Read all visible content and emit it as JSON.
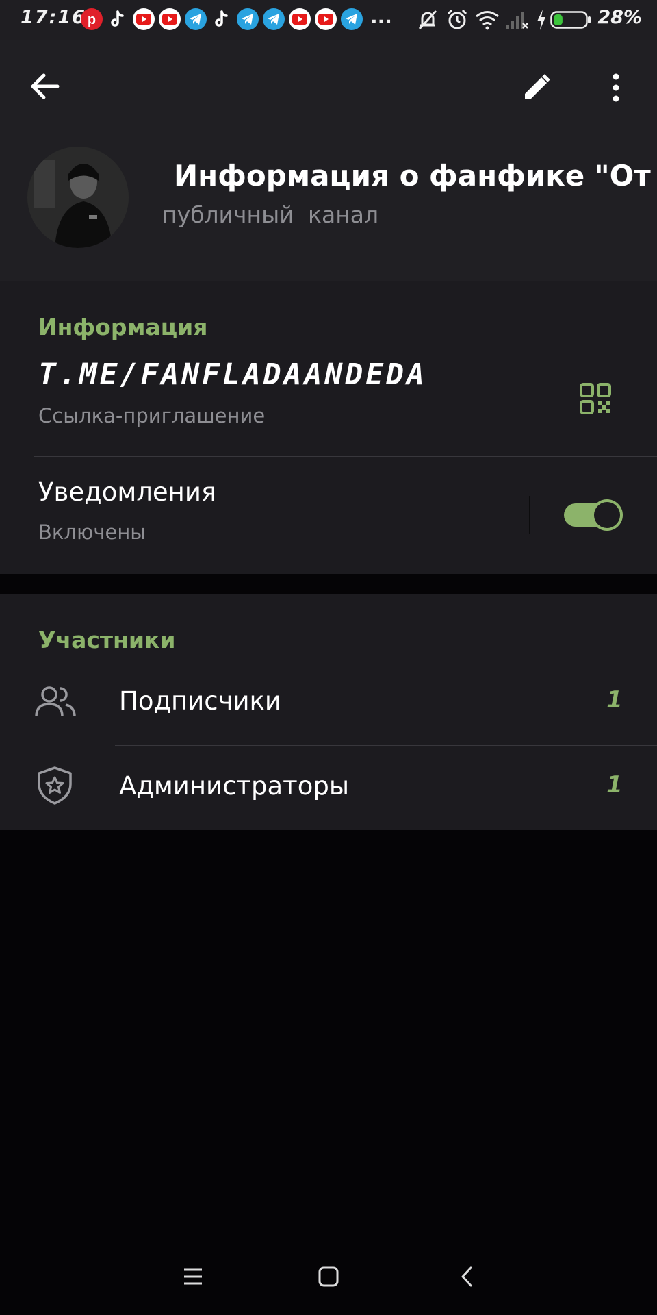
{
  "status_bar": {
    "time": "17:16",
    "more": "...",
    "battery_percent": "28%",
    "battery_level": 0.28,
    "notification_icons": [
      "pinterest-icon",
      "tiktok-icon",
      "youtube-icon",
      "youtube-icon",
      "telegram-icon",
      "tiktok-icon",
      "telegram-icon",
      "telegram-icon",
      "youtube-icon",
      "youtube-icon",
      "telegram-icon"
    ]
  },
  "header": {
    "title": "Информация о фанфике \"От н",
    "subtitle": "публичный канал"
  },
  "info": {
    "section_title": "Информация",
    "link": "t.me/fanfladaandeda",
    "link_caption": "Ссылка-приглашение",
    "notifications_label": "Уведомления",
    "notifications_state": "Включены",
    "notifications_enabled": true
  },
  "participants": {
    "section_title": "Участники",
    "rows": [
      {
        "label": "Подписчики",
        "count": "1",
        "icon": "people-icon"
      },
      {
        "label": "Администраторы",
        "count": "1",
        "icon": "shield-star-icon"
      }
    ]
  },
  "colors": {
    "accent": "#8cb36a",
    "background": "#050406",
    "card": "#1c1b1f",
    "header": "#201f23"
  }
}
